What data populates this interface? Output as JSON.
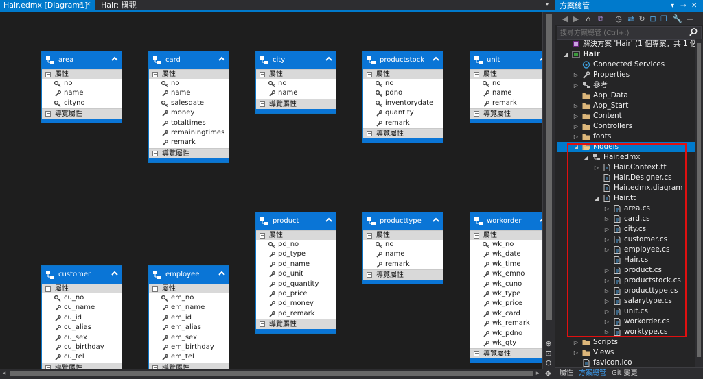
{
  "tabs": {
    "active": "Hair.edmx [Diagram1]",
    "pin_icon": "pin-icon",
    "close_icon": "close-icon",
    "second": "Hair: 概觀"
  },
  "sections": {
    "props": "屬性",
    "nav": "導覽屬性"
  },
  "entities": [
    {
      "title": "area",
      "props": [
        [
          "no",
          "key"
        ],
        [
          "name",
          "prop"
        ],
        [
          "cityno",
          "key"
        ]
      ]
    },
    {
      "title": "card",
      "props": [
        [
          "no",
          "key"
        ],
        [
          "name",
          "prop"
        ],
        [
          "salesdate",
          "key"
        ],
        [
          "money",
          "prop"
        ],
        [
          "totaltimes",
          "prop"
        ],
        [
          "remainingtimes",
          "prop"
        ],
        [
          "remark",
          "prop"
        ]
      ]
    },
    {
      "title": "city",
      "props": [
        [
          "no",
          "key"
        ],
        [
          "name",
          "prop"
        ]
      ]
    },
    {
      "title": "productstock",
      "props": [
        [
          "no",
          "key"
        ],
        [
          "pdno",
          "key"
        ],
        [
          "inventorydate",
          "key"
        ],
        [
          "quantity",
          "prop"
        ],
        [
          "remark",
          "prop"
        ]
      ]
    },
    {
      "title": "unit",
      "props": [
        [
          "no",
          "key"
        ],
        [
          "name",
          "prop"
        ],
        [
          "remark",
          "prop"
        ]
      ]
    },
    {
      "title": "product",
      "props": [
        [
          "pd_no",
          "key"
        ],
        [
          "pd_type",
          "prop"
        ],
        [
          "pd_name",
          "prop"
        ],
        [
          "pd_unit",
          "prop"
        ],
        [
          "pd_quantity",
          "prop"
        ],
        [
          "pd_price",
          "prop"
        ],
        [
          "pd_money",
          "prop"
        ],
        [
          "pd_remark",
          "prop"
        ]
      ]
    },
    {
      "title": "producttype",
      "props": [
        [
          "no",
          "key"
        ],
        [
          "name",
          "prop"
        ],
        [
          "remark",
          "prop"
        ]
      ]
    },
    {
      "title": "workorder",
      "props": [
        [
          "wk_no",
          "key"
        ],
        [
          "wk_date",
          "prop"
        ],
        [
          "wk_time",
          "prop"
        ],
        [
          "wk_emno",
          "prop"
        ],
        [
          "wk_cuno",
          "prop"
        ],
        [
          "wk_type",
          "prop"
        ],
        [
          "wk_price",
          "prop"
        ],
        [
          "wk_card",
          "prop"
        ],
        [
          "wk_remark",
          "prop"
        ],
        [
          "wk_pdno",
          "prop"
        ],
        [
          "wk_qty",
          "prop"
        ]
      ]
    },
    {
      "title": "customer",
      "props": [
        [
          "cu_no",
          "key"
        ],
        [
          "cu_name",
          "prop"
        ],
        [
          "cu_id",
          "prop"
        ],
        [
          "cu_alias",
          "prop"
        ],
        [
          "cu_sex",
          "prop"
        ],
        [
          "cu_birthday",
          "prop"
        ],
        [
          "cu_tel",
          "prop"
        ]
      ]
    },
    {
      "title": "employee",
      "props": [
        [
          "em_no",
          "key"
        ],
        [
          "em_name",
          "prop"
        ],
        [
          "em_id",
          "prop"
        ],
        [
          "em_alias",
          "prop"
        ],
        [
          "em_sex",
          "prop"
        ],
        [
          "em_birthday",
          "prop"
        ],
        [
          "em_tel",
          "prop"
        ]
      ]
    }
  ],
  "solution_explorer": {
    "title": "方案總管",
    "search_placeholder": "搜尋方案總管 (Ctrl+;)",
    "tree": [
      {
        "label": "解決方案 'Hair' (1 個專案，共 1 個)",
        "depth": 0,
        "arrow": "",
        "icon": "solution-icon"
      },
      {
        "label": "Hair",
        "depth": 0,
        "arrow": "open",
        "icon": "web-project-icon",
        "bold": true
      },
      {
        "label": "Connected Services",
        "depth": 1,
        "arrow": "",
        "icon": "connected-services-icon"
      },
      {
        "label": "Properties",
        "depth": 1,
        "arrow": "closed",
        "icon": "wrench-icon"
      },
      {
        "label": "參考",
        "depth": 1,
        "arrow": "closed",
        "icon": "references-icon"
      },
      {
        "label": "App_Data",
        "depth": 1,
        "arrow": "",
        "icon": "folder-icon"
      },
      {
        "label": "App_Start",
        "depth": 1,
        "arrow": "closed",
        "icon": "folder-icon"
      },
      {
        "label": "Content",
        "depth": 1,
        "arrow": "closed",
        "icon": "folder-icon"
      },
      {
        "label": "Controllers",
        "depth": 1,
        "arrow": "closed",
        "icon": "folder-icon"
      },
      {
        "label": "fonts",
        "depth": 1,
        "arrow": "closed",
        "icon": "folder-icon"
      },
      {
        "label": "Models",
        "depth": 1,
        "arrow": "open",
        "icon": "folder-open-icon",
        "selected": true
      },
      {
        "label": "Hair.edmx",
        "depth": 2,
        "arrow": "open",
        "icon": "edmx-icon"
      },
      {
        "label": "Hair.Context.tt",
        "depth": 3,
        "arrow": "closed",
        "icon": "file-icon"
      },
      {
        "label": "Hair.Designer.cs",
        "depth": 3,
        "arrow": "",
        "icon": "file-icon"
      },
      {
        "label": "Hair.edmx.diagram",
        "depth": 3,
        "arrow": "",
        "icon": "file-icon"
      },
      {
        "label": "Hair.tt",
        "depth": 3,
        "arrow": "open",
        "icon": "file-icon"
      },
      {
        "label": "area.cs",
        "depth": 4,
        "arrow": "closed",
        "icon": "cs-file-icon"
      },
      {
        "label": "card.cs",
        "depth": 4,
        "arrow": "closed",
        "icon": "cs-file-icon"
      },
      {
        "label": "city.cs",
        "depth": 4,
        "arrow": "closed",
        "icon": "cs-file-icon"
      },
      {
        "label": "customer.cs",
        "depth": 4,
        "arrow": "closed",
        "icon": "cs-file-icon"
      },
      {
        "label": "employee.cs",
        "depth": 4,
        "arrow": "closed",
        "icon": "cs-file-icon"
      },
      {
        "label": "Hair.cs",
        "depth": 4,
        "arrow": "",
        "icon": "cs-file-icon"
      },
      {
        "label": "product.cs",
        "depth": 4,
        "arrow": "closed",
        "icon": "cs-file-icon"
      },
      {
        "label": "productstock.cs",
        "depth": 4,
        "arrow": "closed",
        "icon": "cs-file-icon"
      },
      {
        "label": "producttype.cs",
        "depth": 4,
        "arrow": "closed",
        "icon": "cs-file-icon"
      },
      {
        "label": "salarytype.cs",
        "depth": 4,
        "arrow": "closed",
        "icon": "cs-file-icon"
      },
      {
        "label": "unit.cs",
        "depth": 4,
        "arrow": "closed",
        "icon": "cs-file-icon"
      },
      {
        "label": "workorder.cs",
        "depth": 4,
        "arrow": "closed",
        "icon": "cs-file-icon"
      },
      {
        "label": "worktype.cs",
        "depth": 4,
        "arrow": "closed",
        "icon": "cs-file-icon"
      },
      {
        "label": "Scripts",
        "depth": 1,
        "arrow": "closed",
        "icon": "folder-icon"
      },
      {
        "label": "Views",
        "depth": 1,
        "arrow": "closed",
        "icon": "folder-icon"
      },
      {
        "label": "favicon.ico",
        "depth": 1,
        "arrow": "",
        "icon": "file-icon"
      }
    ],
    "bottom_tabs": [
      "屬性",
      "方案總管",
      "Git 變更"
    ]
  },
  "colors": {
    "accent": "#007acc",
    "entity_header": "#0a75d6",
    "highlight": "#e01010"
  }
}
